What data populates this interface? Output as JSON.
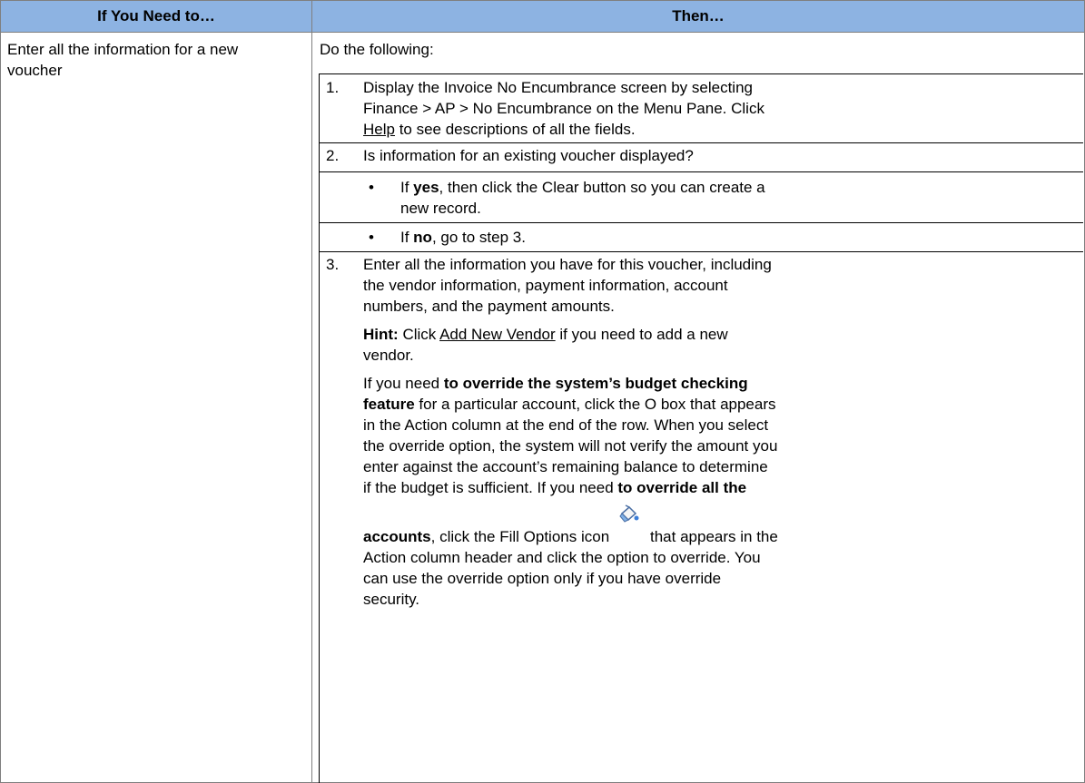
{
  "header": {
    "col1": "If You Need to…",
    "col2": "Then…"
  },
  "row": {
    "task_line1": "Enter all the information for a new",
    "task_line2": "voucher",
    "intro": "Do the following:",
    "step1": {
      "num": "1.",
      "line1": "Display the Invoice No Encumbrance screen by selecting",
      "line2": "Finance > AP > No Encumbrance on the Menu Pane. Click",
      "link": "Help",
      "line3_rest": " to see descriptions of all the fields."
    },
    "step2": {
      "num": "2.",
      "text": "Is information for an existing voucher displayed?",
      "bullet": "•",
      "yes_pre": "If ",
      "yes_bold": "yes",
      "yes_line1_rest": ", then click the Clear button so you can create a",
      "yes_line2": "new record.",
      "no_pre": "If ",
      "no_bold": "no",
      "no_rest": ", go to step 3."
    },
    "step3": {
      "num": "3.",
      "line1": "Enter all the information you have for this voucher, including",
      "line2": "the vendor information, payment information, account",
      "line3": "numbers, and the payment amounts.",
      "hint_label": "Hint:",
      "hint_pre": " Click ",
      "hint_link": "Add New Vendor",
      "hint_post": " if you need to add a new",
      "hint_line2": "vendor.",
      "p_l1_pre": "If you need ",
      "p_l1_bold": "to override the system’s budget checking",
      "p_l2_bold": "feature",
      "p_l2_rest": " for a particular account, click the O box that appears",
      "p_l3": "in the Action column at the end of the row. When you select",
      "p_l4": "the override option, the system will not verify the amount you",
      "p_l5": "enter against the account’s remaining balance to determine",
      "p_l6_pre": "if the budget is sufficient. If you need ",
      "p_l6_bold": "to override all the",
      "p_l7_bold": "accounts",
      "p_l7_mid": ", click the Fill Options icon",
      "p_l7_post": "that appears in the",
      "p_l8": "Action column header and click the option to override. You",
      "p_l9": "can use the override option only if you have override",
      "p_l10": "security."
    }
  },
  "colors": {
    "header_bg": "#8db3e2",
    "border": "#7f7f7f"
  },
  "icons": {
    "fill_options": "fill-options-paint-bucket-icon"
  }
}
